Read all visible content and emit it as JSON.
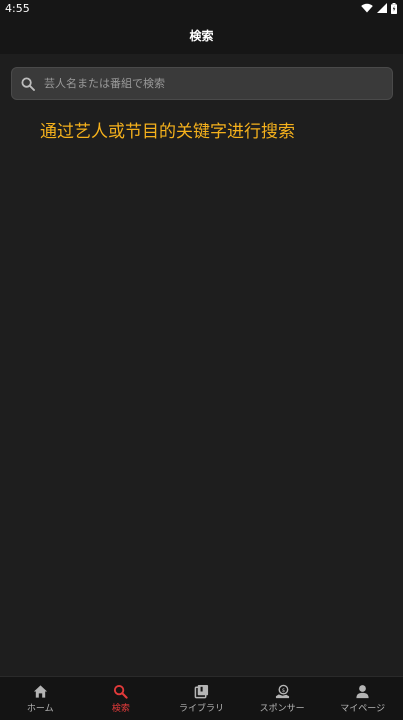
{
  "status_bar": {
    "time": "4:55",
    "icons": [
      "wifi-icon",
      "signal-icon",
      "battery-icon"
    ]
  },
  "app_bar": {
    "title": "検索"
  },
  "search": {
    "placeholder": "芸人名または番組で検索",
    "value": ""
  },
  "hint": {
    "text": "通过艺人或节目的关键字进行搜索"
  },
  "bottom_nav": {
    "items": [
      {
        "label": "ホーム",
        "icon": "home-icon",
        "active": false
      },
      {
        "label": "検索",
        "icon": "search-icon",
        "active": true
      },
      {
        "label": "ライブラリ",
        "icon": "library-icon",
        "active": false
      },
      {
        "label": "スポンサー",
        "icon": "sponsor-icon",
        "active": false
      },
      {
        "label": "マイページ",
        "icon": "person-icon",
        "active": false
      }
    ]
  },
  "colors": {
    "background": "#1e1e1e",
    "bar": "#161616",
    "accent_active": "#e23a3a",
    "hint": "#f5b11c"
  }
}
